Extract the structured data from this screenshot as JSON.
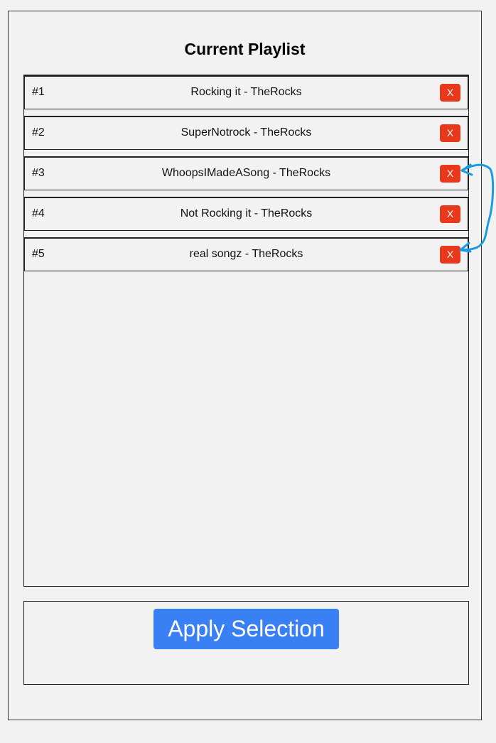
{
  "playlist": {
    "title": "Current Playlist",
    "items": [
      {
        "number": "#1",
        "title": "Rocking it - TheRocks",
        "remove_label": "X"
      },
      {
        "number": "#2",
        "title": "SuperNotrock - TheRocks",
        "remove_label": "X"
      },
      {
        "number": "#3",
        "title": "WhoopsIMadeASong - TheRocks",
        "remove_label": "X"
      },
      {
        "number": "#4",
        "title": "Not Rocking it - TheRocks",
        "remove_label": "X"
      },
      {
        "number": "#5",
        "title": "real songz - TheRocks",
        "remove_label": "X"
      }
    ]
  },
  "apply": {
    "label": "Apply Selection"
  },
  "colors": {
    "background": "#f2f2f2",
    "remove_button": "#e8391c",
    "apply_button": "#3a80f5",
    "annotation_stroke": "#1a9be0"
  }
}
